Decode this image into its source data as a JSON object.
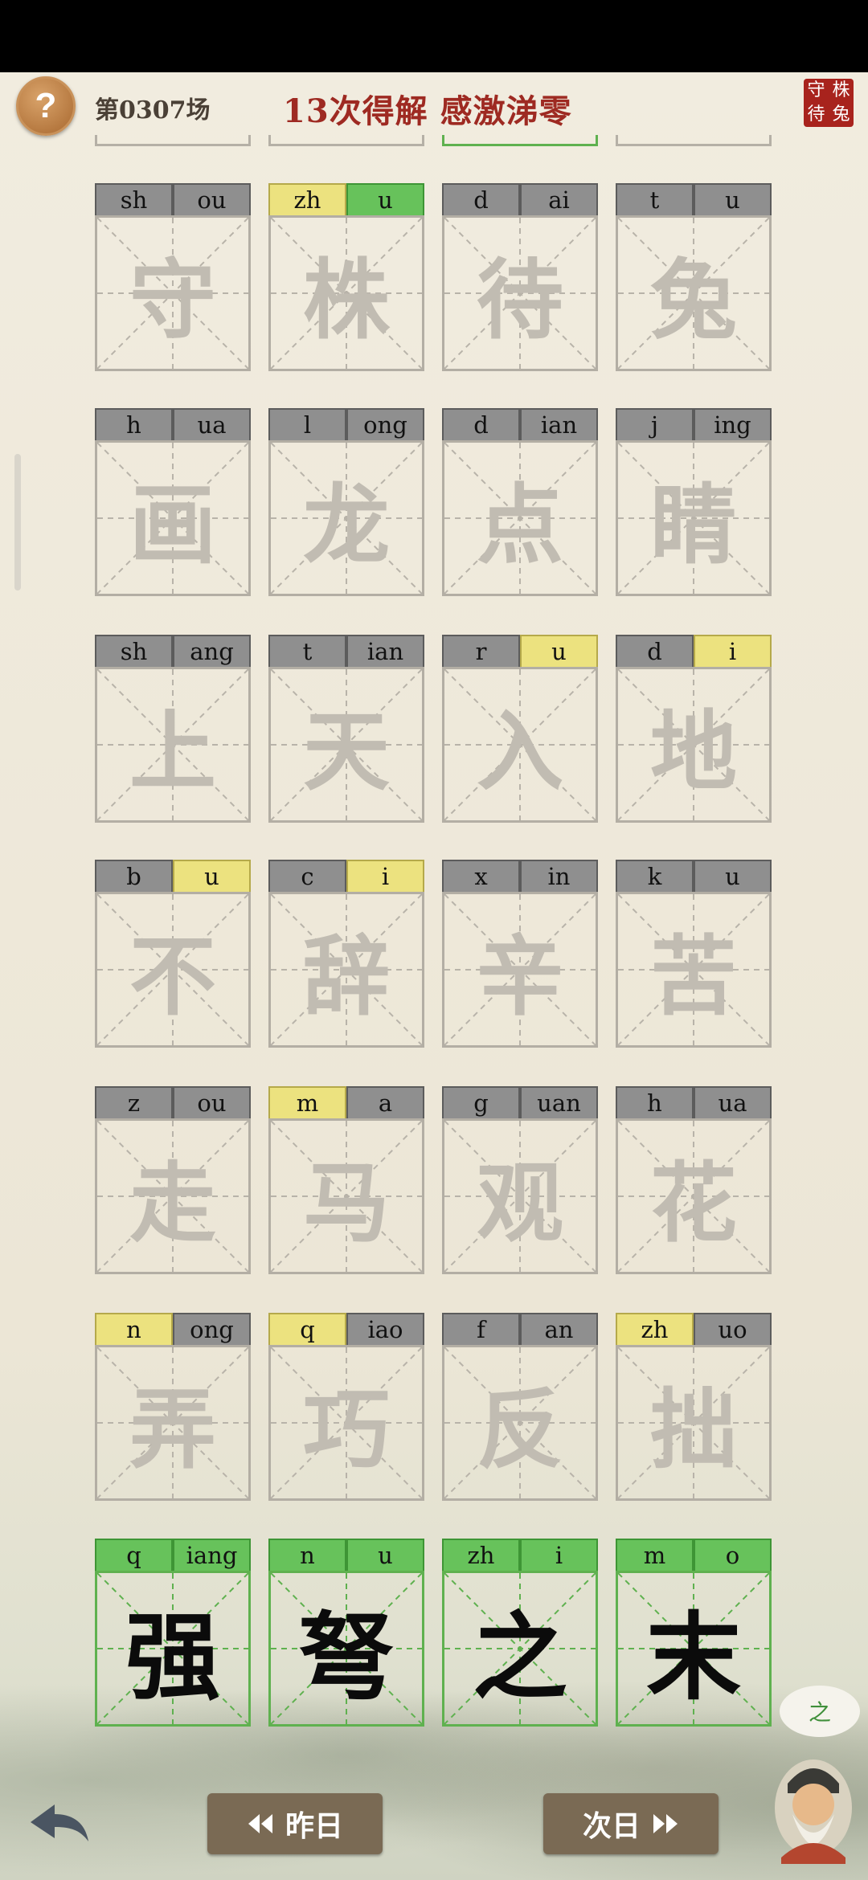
{
  "header": {
    "round": "第0307场",
    "result": "13次得解  感激涕零",
    "seal_chars": [
      "守",
      "株",
      "待",
      "兔"
    ]
  },
  "rows": [
    [
      {
        "pinyin": [
          "sh",
          "ou"
        ],
        "colors": [
          "n",
          "n"
        ],
        "hanzi": "守"
      },
      {
        "pinyin": [
          "zh",
          "u"
        ],
        "colors": [
          "y",
          "g"
        ],
        "hanzi": "株"
      },
      {
        "pinyin": [
          "d",
          "ai"
        ],
        "colors": [
          "n",
          "n"
        ],
        "hanzi": "待"
      },
      {
        "pinyin": [
          "t",
          "u"
        ],
        "colors": [
          "n",
          "n"
        ],
        "hanzi": "兔"
      }
    ],
    [
      {
        "pinyin": [
          "h",
          "ua"
        ],
        "colors": [
          "n",
          "n"
        ],
        "hanzi": "画"
      },
      {
        "pinyin": [
          "l",
          "ong"
        ],
        "colors": [
          "n",
          "n"
        ],
        "hanzi": "龙"
      },
      {
        "pinyin": [
          "d",
          "ian"
        ],
        "colors": [
          "n",
          "n"
        ],
        "hanzi": "点"
      },
      {
        "pinyin": [
          "j",
          "ing"
        ],
        "colors": [
          "n",
          "n"
        ],
        "hanzi": "睛"
      }
    ],
    [
      {
        "pinyin": [
          "sh",
          "ang"
        ],
        "colors": [
          "n",
          "n"
        ],
        "hanzi": "上"
      },
      {
        "pinyin": [
          "t",
          "ian"
        ],
        "colors": [
          "n",
          "n"
        ],
        "hanzi": "天"
      },
      {
        "pinyin": [
          "r",
          "u"
        ],
        "colors": [
          "n",
          "y"
        ],
        "hanzi": "入"
      },
      {
        "pinyin": [
          "d",
          "i"
        ],
        "colors": [
          "n",
          "y"
        ],
        "hanzi": "地"
      }
    ],
    [
      {
        "pinyin": [
          "b",
          "u"
        ],
        "colors": [
          "n",
          "y"
        ],
        "hanzi": "不"
      },
      {
        "pinyin": [
          "c",
          "i"
        ],
        "colors": [
          "n",
          "y"
        ],
        "hanzi": "辞"
      },
      {
        "pinyin": [
          "x",
          "in"
        ],
        "colors": [
          "n",
          "n"
        ],
        "hanzi": "辛"
      },
      {
        "pinyin": [
          "k",
          "u"
        ],
        "colors": [
          "n",
          "n"
        ],
        "hanzi": "苦"
      }
    ],
    [
      {
        "pinyin": [
          "z",
          "ou"
        ],
        "colors": [
          "n",
          "n"
        ],
        "hanzi": "走"
      },
      {
        "pinyin": [
          "m",
          "a"
        ],
        "colors": [
          "y",
          "n"
        ],
        "hanzi": "马"
      },
      {
        "pinyin": [
          "g",
          "uan"
        ],
        "colors": [
          "n",
          "n"
        ],
        "hanzi": "观"
      },
      {
        "pinyin": [
          "h",
          "ua"
        ],
        "colors": [
          "n",
          "n"
        ],
        "hanzi": "花"
      }
    ],
    [
      {
        "pinyin": [
          "n",
          "ong"
        ],
        "colors": [
          "y",
          "n"
        ],
        "hanzi": "弄"
      },
      {
        "pinyin": [
          "q",
          "iao"
        ],
        "colors": [
          "y",
          "n"
        ],
        "hanzi": "巧"
      },
      {
        "pinyin": [
          "f",
          "an"
        ],
        "colors": [
          "n",
          "n"
        ],
        "hanzi": "反"
      },
      {
        "pinyin": [
          "zh",
          "uo"
        ],
        "colors": [
          "y",
          "n"
        ],
        "hanzi": "拙"
      }
    ],
    [
      {
        "pinyin": [
          "q",
          "iang"
        ],
        "colors": [
          "g",
          "g"
        ],
        "hanzi": "强"
      },
      {
        "pinyin": [
          "n",
          "u"
        ],
        "colors": [
          "g",
          "g"
        ],
        "hanzi": "弩"
      },
      {
        "pinyin": [
          "zh",
          "i"
        ],
        "colors": [
          "g",
          "g"
        ],
        "hanzi": "之"
      },
      {
        "pinyin": [
          "m",
          "o"
        ],
        "colors": [
          "g",
          "g"
        ],
        "hanzi": "末"
      }
    ]
  ],
  "nav": {
    "prev_label": "昨日",
    "next_label": "次日",
    "prev_icon": "double-left-arrow-icon",
    "next_icon": "double-right-arrow-icon"
  },
  "helper": {
    "bubble_text": "之"
  }
}
